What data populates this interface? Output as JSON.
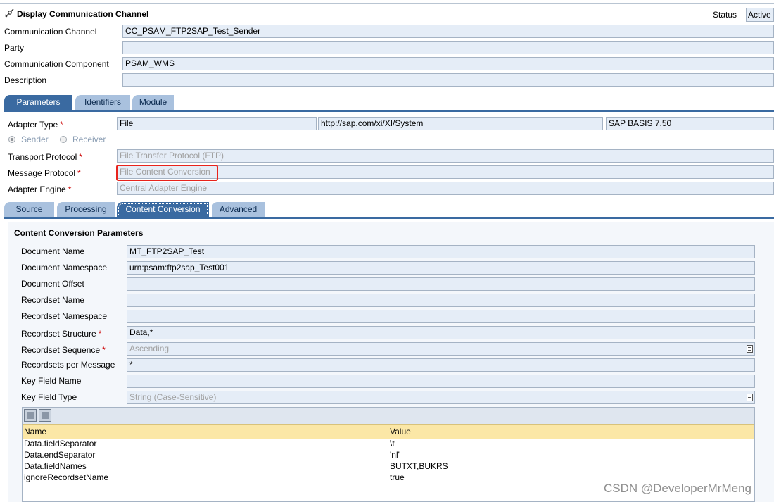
{
  "header": {
    "title": "Display Communication Channel",
    "status_label": "Status",
    "status_value": "Active"
  },
  "channel": {
    "communication_channel_label": "Communication Channel",
    "communication_channel_value": "CC_PSAM_FTP2SAP_Test_Sender",
    "party_label": "Party",
    "party_value": "",
    "communication_component_label": "Communication Component",
    "communication_component_value": "PSAM_WMS",
    "description_label": "Description",
    "description_value": ""
  },
  "main_tabs": [
    "Parameters",
    "Identifiers",
    "Module"
  ],
  "parameters": {
    "adapter_type_label": "Adapter Type",
    "adapter_type_value": "File",
    "adapter_namespace_value": "http://sap.com/xi/XI/System",
    "adapter_swcv_value": "SAP BASIS 7.50",
    "sender_label": "Sender",
    "receiver_label": "Receiver",
    "transport_protocol_label": "Transport Protocol",
    "transport_protocol_value": "File Transfer Protocol (FTP)",
    "message_protocol_label": "Message Protocol",
    "message_protocol_value": "File Content Conversion",
    "adapter_engine_label": "Adapter Engine",
    "adapter_engine_value": "Central Adapter Engine",
    "required_mark": "*"
  },
  "sub_tabs": [
    "Source",
    "Processing",
    "Content Conversion",
    "Advanced"
  ],
  "content_conversion": {
    "section_title": "Content Conversion Parameters",
    "document_name_label": "Document Name",
    "document_name_value": "MT_FTP2SAP_Test",
    "document_namespace_label": "Document Namespace",
    "document_namespace_value": "urn:psam:ftp2sap_Test001",
    "document_offset_label": "Document Offset",
    "document_offset_value": "",
    "recordset_name_label": "Recordset Name",
    "recordset_name_value": "",
    "recordset_namespace_label": "Recordset Namespace",
    "recordset_namespace_value": "",
    "recordset_structure_label": "Recordset Structure",
    "recordset_structure_value": "Data,*",
    "recordset_sequence_label": "Recordset Sequence",
    "recordset_sequence_value": "Ascending",
    "recordsets_per_message_label": "Recordsets per Message",
    "recordsets_per_message_value": "*",
    "key_field_name_label": "Key Field Name",
    "key_field_name_value": "",
    "key_field_type_label": "Key Field Type",
    "key_field_type_value": "String (Case-Sensitive)"
  },
  "table": {
    "columns": [
      "Name",
      "Value"
    ],
    "rows": [
      [
        "Data.fieldSeparator",
        "\\t"
      ],
      [
        "Data.endSeparator",
        "'nl'"
      ],
      [
        "Data.fieldNames",
        "BUTXT,BUKRS"
      ],
      [
        "ignoreRecordsetName",
        "true"
      ]
    ]
  },
  "watermark": "CSDN @DeveloperMrMeng",
  "colors": {
    "field_bg": "#e5edf7",
    "tab_selected": "#3a6aa1",
    "tab_unselected": "#a9c1de",
    "table_header": "#fbe7a6",
    "required": "#cc0000",
    "highlight": "#e8231c"
  }
}
